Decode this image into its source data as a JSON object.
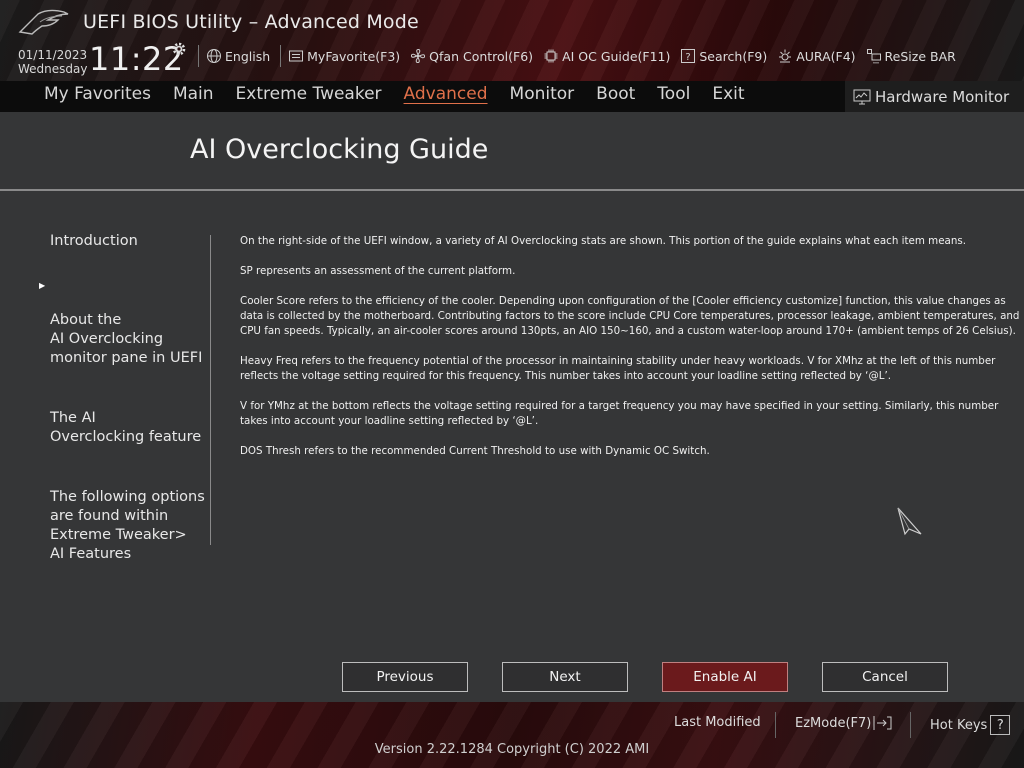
{
  "header": {
    "title": "UEFI BIOS Utility – Advanced Mode",
    "date": "01/11/2023",
    "weekday": "Wednesday",
    "time": "11:22",
    "toolbar": [
      {
        "label": "English",
        "icon": "globe-icon"
      },
      {
        "label": "MyFavorite(F3)",
        "icon": "favorite-icon"
      },
      {
        "label": "Qfan Control(F6)",
        "icon": "fan-icon"
      },
      {
        "label": "AI OC Guide(F11)",
        "icon": "chip-icon"
      },
      {
        "label": "Search(F9)",
        "icon": "search-help-icon"
      },
      {
        "label": "AURA(F4)",
        "icon": "aura-light-icon"
      },
      {
        "label": "ReSize BAR",
        "icon": "resize-bar-icon"
      }
    ]
  },
  "menu": {
    "items": [
      "My Favorites",
      "Main",
      "Extreme Tweaker",
      "Advanced",
      "Monitor",
      "Boot",
      "Tool",
      "Exit"
    ],
    "active": "Advanced",
    "hardware_monitor": "Hardware Monitor"
  },
  "guide": {
    "title": "AI Overclocking Guide",
    "nav": [
      {
        "label": "Introduction",
        "selected": false
      },
      {
        "label": "About the\nAI Overclocking\nmonitor pane in UEFI",
        "selected": true
      },
      {
        "label": "The AI\nOverclocking feature",
        "selected": false
      },
      {
        "label": "The following options\nare found within\nExtreme Tweaker>\nAI Features",
        "selected": false
      }
    ],
    "paragraphs": [
      "On the right-side of the UEFI window, a variety of AI Overclocking stats are shown. This portion of the guide explains what each item means.",
      "SP represents an assessment of the current platform.",
      "Cooler Score refers to the efficiency of the cooler. Depending upon configuration of the [Cooler efficiency customize] function, this value changes as data is collected by the motherboard. Contributing factors to the score include CPU Core temperatures, processor leakage, ambient temperatures, and CPU fan speeds. Typically, an air-cooler scores around 130pts, an AIO 150~160, and a custom water-loop around 170+ (ambient temps of 26 Celsius).",
      "Heavy Freq refers to the frequency potential of the processor in maintaining stability under heavy workloads. V for XMhz at the left of this number reflects the voltage setting required for this frequency. This number takes into account your loadline setting reflected by ‘@L’.",
      "V for YMhz at the bottom reflects the voltage setting required for a target frequency you may have specified in your setting. Similarly, this number takes into account your loadline setting reflected by ‘@L’.",
      "DOS Thresh refers to the recommended Current Threshold to use with Dynamic OC Switch."
    ],
    "buttons": {
      "previous": "Previous",
      "next": "Next",
      "enable_ai": "Enable AI",
      "cancel": "Cancel"
    }
  },
  "footer": {
    "last_modified": "Last Modified",
    "ezmode": "EzMode(F7)",
    "hotkeys": "Hot Keys",
    "hotkeys_icon": "?",
    "version": "Version 2.22.1284 Copyright (C) 2022 AMI"
  },
  "colors": {
    "accent": "#e0704a",
    "brand_red": "#6b1a1c",
    "panel": "#353637"
  }
}
